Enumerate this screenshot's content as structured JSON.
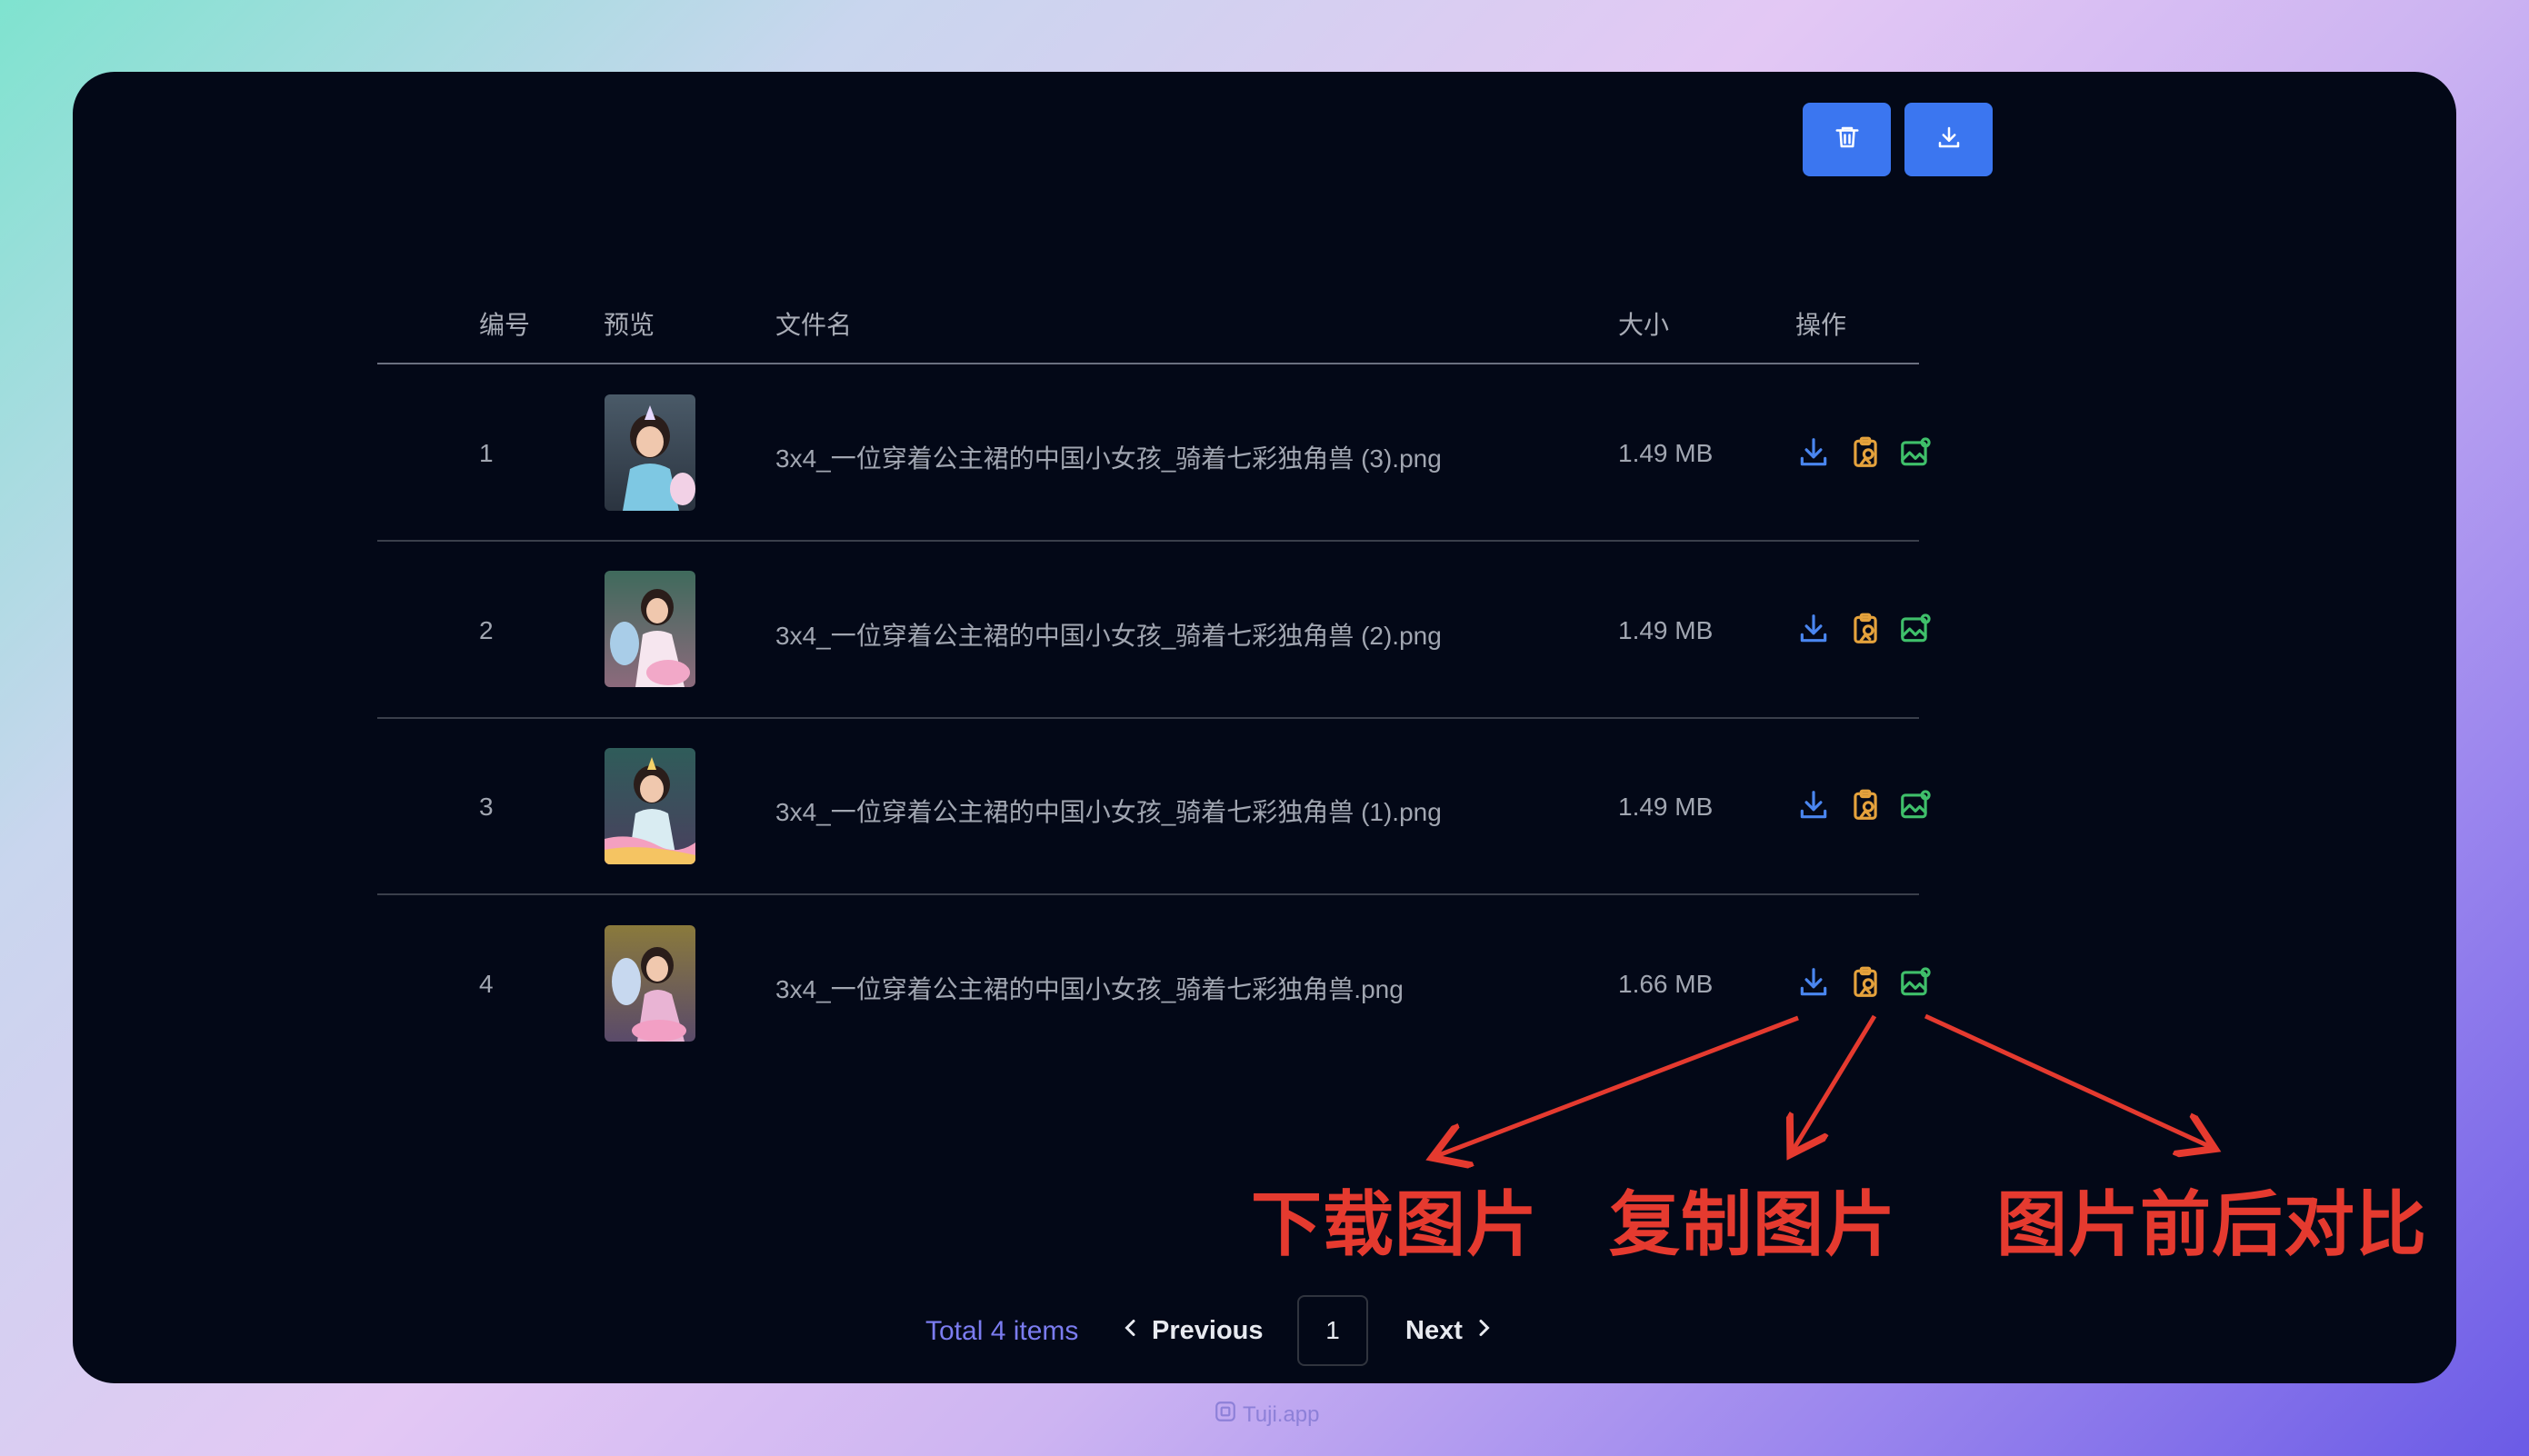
{
  "table": {
    "headers": {
      "index": "编号",
      "preview": "预览",
      "filename": "文件名",
      "size": "大小",
      "actions": "操作"
    },
    "rows": [
      {
        "index": "1",
        "filename": "3x4_一位穿着公主裙的中国小女孩_骑着七彩独角兽 (3).png",
        "size": "1.49 MB"
      },
      {
        "index": "2",
        "filename": "3x4_一位穿着公主裙的中国小女孩_骑着七彩独角兽 (2).png",
        "size": "1.49 MB"
      },
      {
        "index": "3",
        "filename": "3x4_一位穿着公主裙的中国小女孩_骑着七彩独角兽 (1).png",
        "size": "1.49 MB"
      },
      {
        "index": "4",
        "filename": "3x4_一位穿着公主裙的中国小女孩_骑着七彩独角兽.png",
        "size": "1.66 MB"
      }
    ]
  },
  "annotations": {
    "download": "下载图片",
    "copy": "复制图片",
    "compare": "图片前后对比"
  },
  "pagination": {
    "total": "Total 4 items",
    "previous": "Previous",
    "page": "1",
    "next": "Next"
  },
  "watermark": "Tuji.app",
  "icons": {
    "toolbar": [
      "trash-icon",
      "download-icon"
    ],
    "row_actions": [
      "download-icon",
      "clipboard-image-icon",
      "image-compare-icon"
    ]
  },
  "colors": {
    "primary": "#3b76f0",
    "download_icon": "#4a86f0",
    "copy_icon": "#e5a23c",
    "compare_icon": "#3fbf6a",
    "annotation": "#e53a2f",
    "total": "#7b7cf0"
  }
}
